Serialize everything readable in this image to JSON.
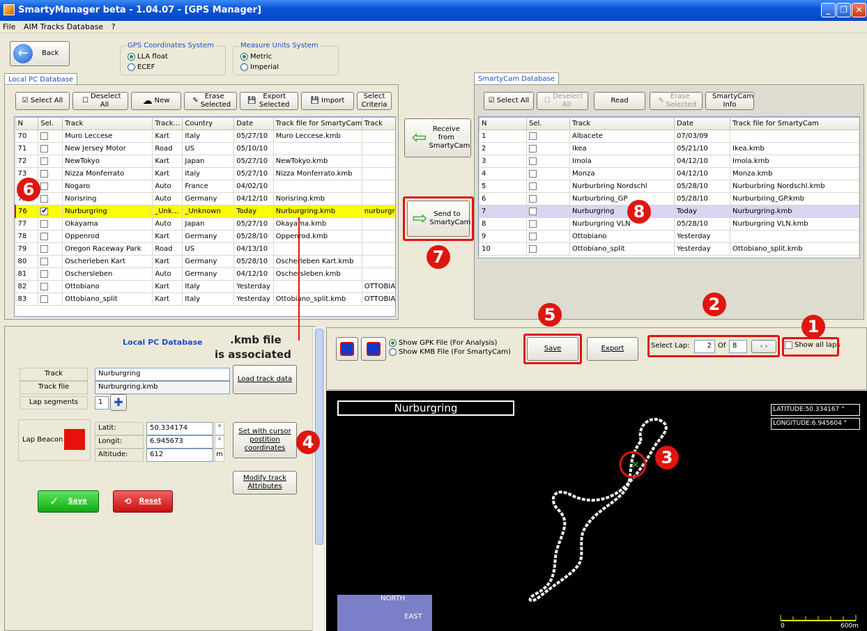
{
  "window": {
    "title": "SmartyManager beta - 1.04.07 - [GPS Manager]"
  },
  "menu": [
    "File",
    "AIM Tracks Database",
    "?"
  ],
  "back_label": "Back",
  "gps_group": {
    "legend": "GPS Coordinates System",
    "opt1": "LLA float",
    "opt2": "ECEF"
  },
  "units_group": {
    "legend": "Measure Units System",
    "opt1": "Metric",
    "opt2": "Imperial"
  },
  "local": {
    "tab": "Local PC Database",
    "toolbar": {
      "select_all": "Select All",
      "deselect_all": "Deselect All",
      "new": "New",
      "erase": "Erase Selected",
      "export": "Export Selected",
      "import": "Import",
      "criteria": "Select Criteria"
    },
    "columns": [
      "N",
      "Sel.",
      "Track",
      "Track...",
      "Country",
      "Date",
      "Track file for SmartyCam",
      "Track"
    ],
    "rows": [
      {
        "n": "70",
        "sel": false,
        "track": "Muro Leccese",
        "type": "Kart",
        "country": "Italy",
        "date": "05/27/10",
        "file": "Muro Leccese.kmb",
        "x": ""
      },
      {
        "n": "71",
        "sel": false,
        "track": "New Jersey Motor",
        "type": "Road",
        "country": "US",
        "date": "05/10/10",
        "file": "",
        "x": ""
      },
      {
        "n": "72",
        "sel": false,
        "track": "NewTokyo",
        "type": "Kart",
        "country": "Japan",
        "date": "05/27/10",
        "file": "NewTokyo.kmb",
        "x": ""
      },
      {
        "n": "73",
        "sel": false,
        "track": "Nizza Monferrato",
        "type": "Kart",
        "country": "Italy",
        "date": "05/27/10",
        "file": "Nizza Monferrato.kmb",
        "x": ""
      },
      {
        "n": "74",
        "sel": false,
        "track": "Nogaro",
        "type": "Auto",
        "country": "France",
        "date": "04/02/10",
        "file": "",
        "x": ""
      },
      {
        "n": "75",
        "sel": false,
        "track": "Norisring",
        "type": "Auto",
        "country": "Germany",
        "date": "04/12/10",
        "file": "Norisring.kmb",
        "x": ""
      },
      {
        "n": "76",
        "sel": true,
        "track": "Nurburgring",
        "type": "_Unk...",
        "country": "_Unknown",
        "date": "Today",
        "file": "Nurburgring.kmb",
        "x": "nurburgr"
      },
      {
        "n": "77",
        "sel": false,
        "track": "Okayama",
        "type": "Auto",
        "country": "Japan",
        "date": "05/27/10",
        "file": "Okayama.kmb",
        "x": ""
      },
      {
        "n": "78",
        "sel": false,
        "track": "Oppenrod",
        "type": "Kart",
        "country": "Germany",
        "date": "05/28/10",
        "file": "Oppenrod.kmb",
        "x": ""
      },
      {
        "n": "79",
        "sel": false,
        "track": "Oregon Raceway Park",
        "type": "Road",
        "country": "US",
        "date": "04/13/10",
        "file": "",
        "x": ""
      },
      {
        "n": "80",
        "sel": false,
        "track": "Oscherleben Kart",
        "type": "Kart",
        "country": "Germany",
        "date": "05/28/10",
        "file": "Oscherleben Kart.kmb",
        "x": ""
      },
      {
        "n": "81",
        "sel": false,
        "track": "Oschersleben",
        "type": "Auto",
        "country": "Germany",
        "date": "04/12/10",
        "file": "Oschersleben.kmb",
        "x": ""
      },
      {
        "n": "82",
        "sel": false,
        "track": "Ottobiano",
        "type": "Kart",
        "country": "Italy",
        "date": "Yesterday",
        "file": "",
        "x": "OTTOBIA"
      },
      {
        "n": "83",
        "sel": false,
        "track": "Ottobiano_split",
        "type": "Kart",
        "country": "Italy",
        "date": "Yesterday",
        "file": "Ottobiano_split.kmb",
        "x": "OTTOBIA"
      }
    ]
  },
  "middle": {
    "receive": "Receive from SmartyCam",
    "send": "Send to SmartyCam"
  },
  "cam": {
    "tab": "SmartyCam Database",
    "toolbar": {
      "select_all": "Select All",
      "deselect_all": "Deselect All",
      "read": "Read",
      "erase": "Erase Selected",
      "info": "SmartyCam Info"
    },
    "columns": [
      "N",
      "Sel.",
      "Track",
      "Date",
      "Track file for SmartyCam"
    ],
    "rows": [
      {
        "n": "1",
        "track": "Albacete",
        "date": "07/03/09",
        "file": ""
      },
      {
        "n": "2",
        "track": "Ikea",
        "date": "05/21/10",
        "file": "Ikea.kmb"
      },
      {
        "n": "3",
        "track": "Imola",
        "date": "04/12/10",
        "file": "Imola.kmb"
      },
      {
        "n": "4",
        "track": "Monza",
        "date": "04/12/10",
        "file": "Monza.kmb"
      },
      {
        "n": "5",
        "track": "Nurburbring Nordschl",
        "date": "05/28/10",
        "file": "Nurburbring Nordschl.kmb"
      },
      {
        "n": "6",
        "track": "Nurburbring_GP",
        "date": "05/28/10",
        "file": "Nurburbring_GP.kmb"
      },
      {
        "n": "7",
        "track": "Nurburgring",
        "date": "Today",
        "file": "Nurburgring.kmb"
      },
      {
        "n": "8",
        "track": "Nurburgring VLN",
        "date": "05/28/10",
        "file": "Nurburgring VLN.kmb"
      },
      {
        "n": "9",
        "track": "Ottobiano",
        "date": "Yesterday",
        "file": ""
      },
      {
        "n": "10",
        "track": "Ottobiano_split",
        "date": "Yesterday",
        "file": "Ottobiano_split.kmb"
      }
    ]
  },
  "detail": {
    "title": "Local PC Database",
    "annotation_line1": ".kmb file",
    "annotation_line2": "is associated",
    "track_label": "Track",
    "track_value": "Nurburgring",
    "file_label": "Track file",
    "file_value": "Nurburgring.kmb",
    "segments_label": "Lap segments",
    "segments_value": "1",
    "load_btn": "Load track data",
    "beacon_label": "Lap Beacon",
    "lat_label": "Latit:",
    "lat_value": "50.334174",
    "lat_unit": "°",
    "lon_label": "Longit:",
    "lon_value": "6.945673",
    "lon_unit": "°",
    "alt_label": "Altitude:",
    "alt_value": "612",
    "alt_unit": "m",
    "cursor_btn": "Set with cursor postition coordinates",
    "modify_btn": "Modify track Attributes",
    "save_btn": "Save",
    "reset_btn": "Reset",
    "beacon_color": "#e8100c"
  },
  "mapbar": {
    "opt_gpk": "Show GPK File (For Analysis)",
    "opt_kmb": "Show KMB File (For SmartyCam)",
    "save": "Save",
    "export": "Export",
    "select_lap_label": "Select Lap:",
    "lap_value": "2",
    "of_label": "Of",
    "lap_total": "8",
    "show_all_laps": "Show all laps"
  },
  "map": {
    "track_name": "Nurburgring",
    "latitude": "LATITUDE:50.334167 °",
    "longitude": "LONGITUDE:6.945604 °",
    "north": "NORTH",
    "east": "EAST",
    "scale_0": "0",
    "scale_end": "600m"
  },
  "markers": [
    "1",
    "2",
    "3",
    "4",
    "5",
    "6",
    "7",
    "8"
  ]
}
